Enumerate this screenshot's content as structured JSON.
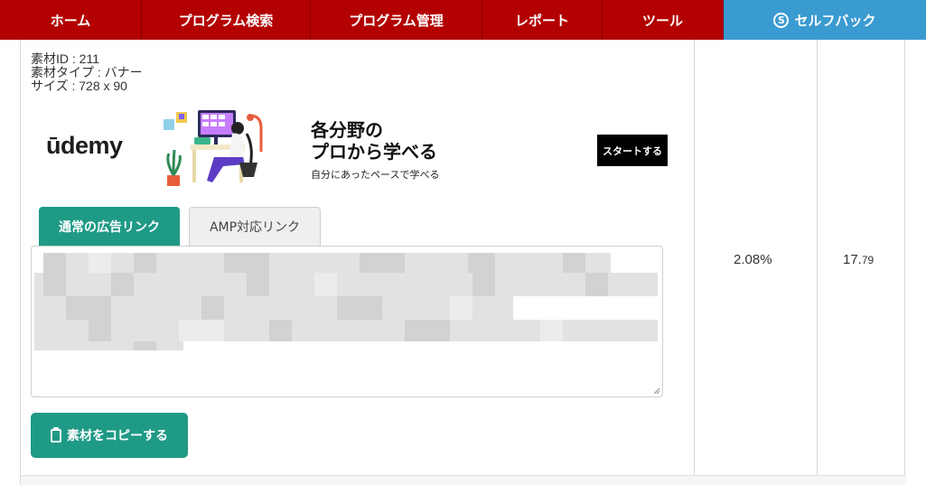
{
  "nav": {
    "items": [
      {
        "label": "ホーム"
      },
      {
        "label": "プログラム検索"
      },
      {
        "label": "プログラム管理"
      },
      {
        "label": "レポート"
      },
      {
        "label": "ツール"
      },
      {
        "label": "セルフバック"
      }
    ],
    "self_icon_glyph": "S",
    "colors": {
      "nav_bg": "#b30000",
      "self_bg": "#3a9bd1"
    }
  },
  "material": {
    "id_line": "素材ID : 211",
    "type_line": "素材タイプ : バナー",
    "size_line": "サイズ : 728 x 90"
  },
  "banner": {
    "logo": "ūdemy",
    "headline_1": "各分野の",
    "headline_2": "プロから学べる",
    "subline": "自分にあったペースで学べる",
    "cta": "スタートする"
  },
  "tabs": {
    "normal": "通常の広告リンク",
    "amp": "AMP対応リンク"
  },
  "copy_button": "素材をコピーする",
  "stats": {
    "rate": "2.08%",
    "value_main": "17.",
    "value_decimal": "79"
  },
  "accent_color": "#1f9a86"
}
